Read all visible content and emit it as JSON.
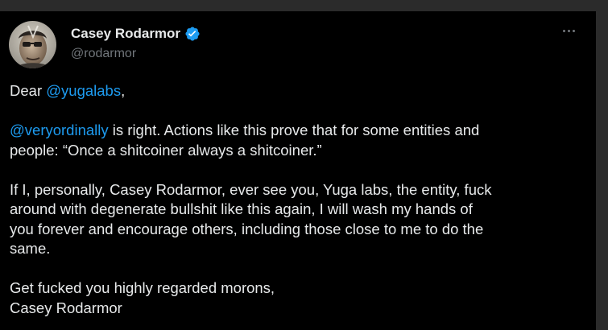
{
  "author": {
    "name": "Casey Rodarmor",
    "handle": "@rodarmor",
    "verified": true
  },
  "icons": {
    "verified": "verified-badge-icon",
    "more": "more-horizontal-icon"
  },
  "colors": {
    "background": "#000000",
    "text": "#e7e9ea",
    "secondary": "#71767b",
    "link": "#1d9bf0",
    "verified_badge": "#1d9bf0"
  },
  "body": {
    "greeting_prefix": "Dear ",
    "greeting_mention": "@yugalabs",
    "greeting_suffix": ",",
    "p2_mention": "@veryordinally",
    "p2_line1_rest": " is right. Actions like this prove that for some entities and",
    "p2_line2": "people: “Once a shitcoiner always a shitcoiner.”",
    "p3_line1": "If I, personally, Casey Rodarmor, ever see you, Yuga labs, the entity, fuck",
    "p3_line2": "around with degenerate bullshit like this again, I will wash my hands of",
    "p3_line3": "you forever and encourage others, including those close to me to do the",
    "p3_line4": "same.",
    "closing_line1": "Get fucked you highly regarded morons,",
    "closing_line2": "Casey Rodarmor"
  }
}
